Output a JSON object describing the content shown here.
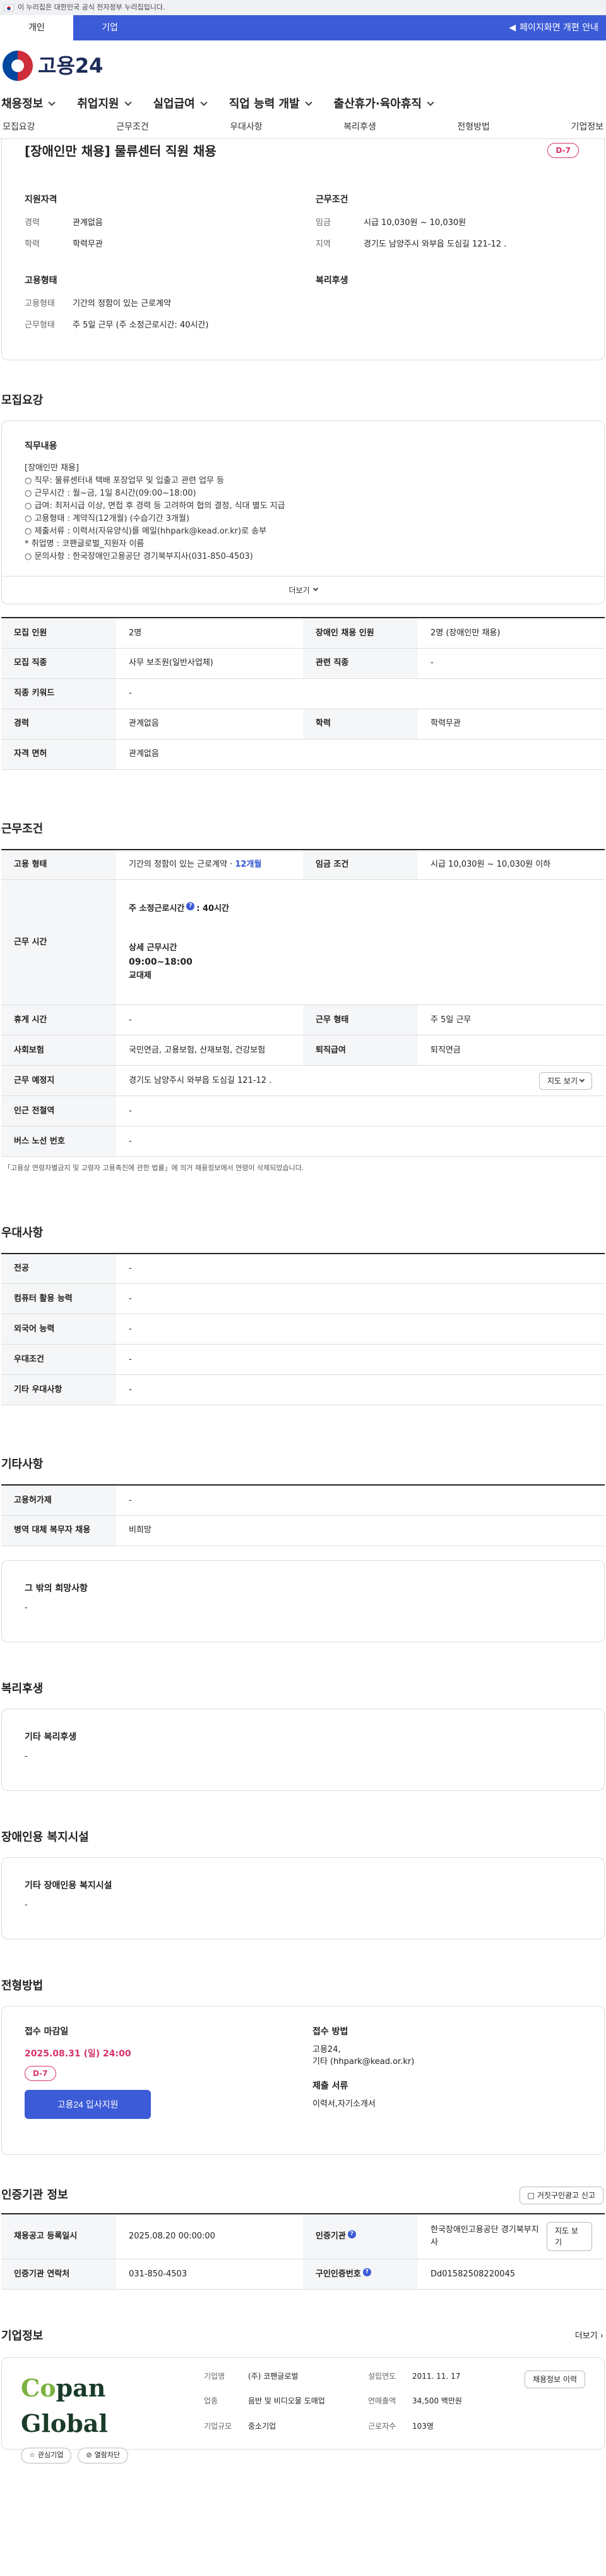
{
  "gov_banner": "이 누리집은 대한민국 공식 전자정부 누리집입니다.",
  "top_tabs": [
    "개인",
    "기업"
  ],
  "top_right": "페이지화면 개편 안내",
  "logo": "고용24",
  "gnb": [
    "채용정보",
    "취업지원",
    "실업급여",
    "직업 능력 개발",
    "출산휴가·육아휴직"
  ],
  "anchor_nav": [
    "모집요강",
    "근무조건",
    "우대사항",
    "복리후생",
    "전형방법",
    "기업정보"
  ],
  "job_title": "[장애인만 채용] 물류센터 직원 채용",
  "dday": "D-7",
  "summary": {
    "qual_title": "지원자격",
    "cond_title": "근무조건",
    "emp_title": "고용형태",
    "welfare_title": "복리후생",
    "qual": [
      {
        "k": "경력",
        "v": "관계없음"
      },
      {
        "k": "학력",
        "v": "학력무관"
      }
    ],
    "cond": [
      {
        "k": "임금",
        "v": "시급 10,030원 ~ 10,030원"
      },
      {
        "k": "지역",
        "v": "경기도 남양주시 와부읍 도심길 121-12 ."
      }
    ],
    "emp": [
      {
        "k": "고용형태",
        "v": "기간의 정함이 있는 근로계약"
      },
      {
        "k": "근무형태",
        "v": "주 5일 근무 (주 소정근로시간: 40시간)"
      }
    ]
  },
  "recruit": {
    "section": "모집요강",
    "box_title": "직무내용",
    "lines": [
      "[장애인만 채용]",
      "○ 직무: 물류센터내 택배 포장업무 및 입출고 관련 업무 등",
      "○ 근무시간 : 월~금, 1일 8시간(09:00~18:00)",
      "○ 급여: 최저시급 이상, 면접 후 경력 등 고려하여 협의 결정, 식대 별도 지급",
      "○ 고용형태 : 계약직(12개월) (수습기간 3개월)",
      "○ 제출서류 : 이력서(자유양식)를 메일(hhpark@kead.or.kr)로 송부",
      "* 취업명 : 코팬글로벌_지원자 이름",
      "○ 문의사항 : 한국장애인고용공단 경기북부지사(031-850-4503)"
    ],
    "more": "더보기",
    "rows": [
      [
        "모집 인원",
        "2명",
        "장애인 채용 인원",
        "2명 (장애인만 채용)"
      ],
      [
        "모집 직종",
        "사무 보조원(일반사업체)",
        "관련 직종",
        "-"
      ],
      [
        "직종 키워드",
        "-",
        "",
        ""
      ],
      [
        "경력",
        "관계없음",
        "학력",
        "학력무관"
      ],
      [
        "자격 면허",
        "관계없음",
        "",
        ""
      ]
    ]
  },
  "work": {
    "section": "근무조건",
    "emp_k": "고용 형태",
    "emp_v": "기간의 정함이 있는 근로계약 · ",
    "emp_months": "12개월",
    "wage_k": "임금 조건",
    "wage_v": "시급 10,030원 ~ 10,030원 이하",
    "time_k": "근무 시간",
    "weekly_label": "주 소정근로시간",
    "weekly_val": ": 40시간",
    "detail_label": "상세 근무시간",
    "hours": "09:00~18:00",
    "shift": "교대제",
    "rest_k": "휴게 시간",
    "rest_v": "-",
    "type_k": "근무 형태",
    "type_v": "주 5일 근무",
    "ins_k": "사회보험",
    "ins_v": "국민연금, 고용보험, 산재보험, 건강보험",
    "sev_k": "퇴직급여",
    "sev_v": "퇴직연금",
    "place_k": "근무 예정지",
    "place_v": "경기도 남양주시 와부읍 도심길 121-12 .",
    "map_btn": "지도 보기",
    "sub_k": "인근 전철역",
    "sub_v": "-",
    "bus_k": "버스 노선 번호",
    "bus_v": "-",
    "note": "「고용상 연령차별금지 및 고령자 고용촉진에 관한 법률」에 의거 채용정보에서 연령이 삭제되었습니다."
  },
  "pref": {
    "section": "우대사항",
    "rows": [
      [
        "전공",
        "-"
      ],
      [
        "컴퓨터 활용 능력",
        "-"
      ],
      [
        "외국어 능력",
        "-"
      ],
      [
        "우대조건",
        "-"
      ],
      [
        "기타 우대사항",
        "-"
      ]
    ]
  },
  "etc": {
    "section": "기타사항",
    "rows": [
      [
        "고용허가제",
        "-"
      ],
      [
        "병역 대체 복무자 채용",
        "비희망"
      ]
    ],
    "box_title": "그 밖의 희망사항",
    "box_val": "-"
  },
  "welfare": {
    "section": "복리후생",
    "box_title": "기타 복리후생",
    "box_val": "-"
  },
  "disability": {
    "section": "장애인용 복지시설",
    "box_title": "기타 장애인용 복지시설",
    "box_val": "-"
  },
  "selection": {
    "section": "전형방법",
    "deadline_label": "접수 마감일",
    "deadline": "2025.08.31 (일) 24:00",
    "dday": "D-7",
    "apply_btn": "고용24 입사지원",
    "method_label": "접수 방법",
    "method_lines": [
      "고용24,",
      "기타 (hhpark@kead.or.kr)"
    ],
    "docs_label": "제출 서류",
    "docs": "이력서,자기소개서"
  },
  "cert": {
    "section": "인증기관 정보",
    "report_btn": "거짓구인광고 신고",
    "reg_k": "채용공고 등록일시",
    "reg_v": "2025.08.20 00:00:00",
    "org_k": "인증기관",
    "org_v": "한국장애인고용공단 경기북부지사",
    "map_btn": "지도 보기",
    "tel_k": "인증기관 연락처",
    "tel_v": "031-850-4503",
    "id_k": "구인인증번호",
    "id_v": "Dd01582508220045"
  },
  "company": {
    "section": "기업정보",
    "more": "더보기",
    "logo_a": "Co",
    "logo_b": "pan Global",
    "fav_btn": "관심기업",
    "block_btn": "열람차단",
    "fields": [
      [
        "기업명",
        "(주) 코팬글로벌",
        "설립연도",
        "2011. 11. 17"
      ],
      [
        "업종",
        "음반 및 비디오물 도매업",
        "연매출액",
        "34,500 백만원"
      ],
      [
        "기업규모",
        "중소기업",
        "근로자수",
        "103명"
      ]
    ],
    "jobs_btn": "채용정보 이력"
  }
}
